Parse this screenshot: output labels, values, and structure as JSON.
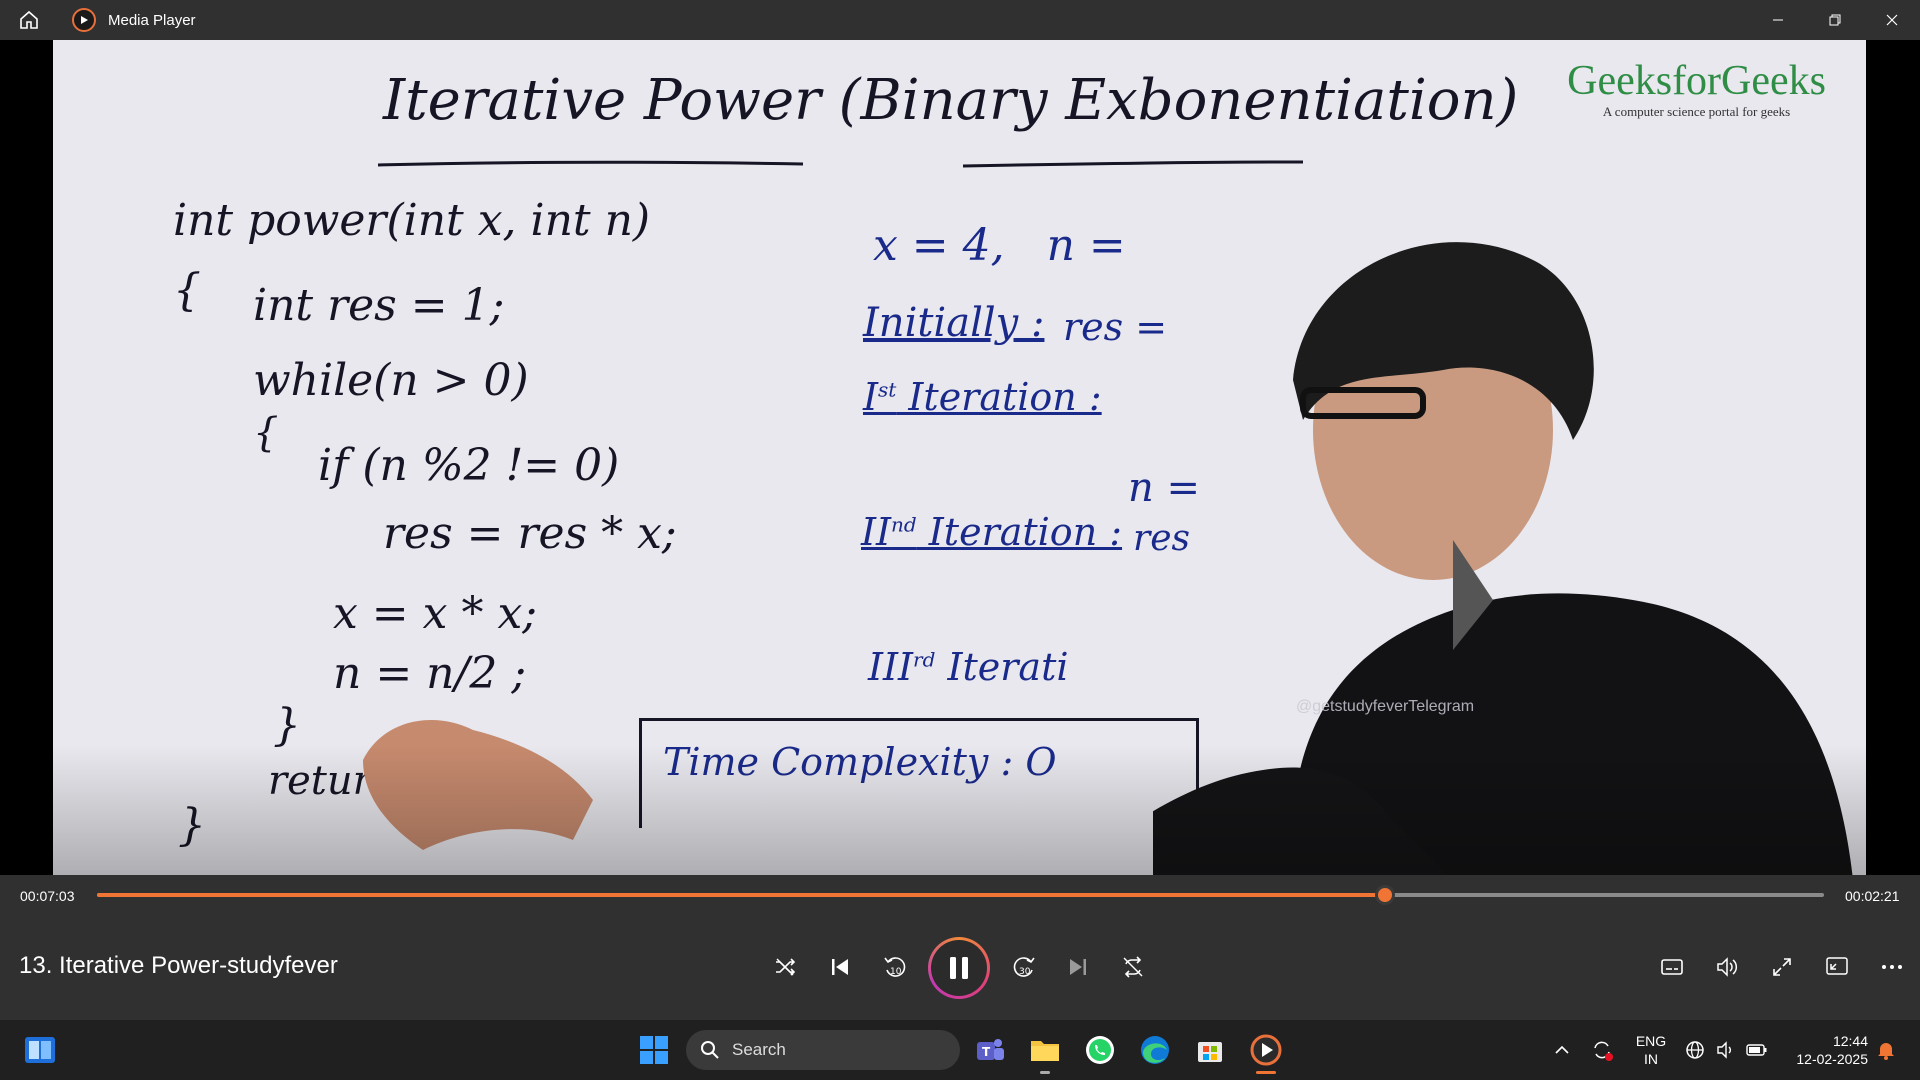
{
  "window": {
    "app_title": "Media Player",
    "controls": [
      "minimize",
      "restore",
      "close"
    ]
  },
  "video": {
    "board_title": "Iterative Power (Binary Exbonentiation)",
    "code_lines": [
      "int power(int x, int n)",
      "{",
      "int res = 1;",
      "while(n > 0)",
      "{",
      "if (n %2 != 0)",
      "res = res * x;",
      "x = x * x;",
      "n = n/2 ;",
      "}",
      "return",
      "}"
    ],
    "board_right": {
      "given": "x = 4,   n =",
      "initially": "Initially :",
      "initially_val": "res =",
      "iter1": "I",
      "iter1_sup": "st",
      "iter1_rest": " Iteration :",
      "n_eq": "n =",
      "iter2": "II",
      "iter2_sup": "nd",
      "iter2_rest": " Iteration :",
      "iter2_val": "res",
      "iter3": "III",
      "iter3_sup": "rd",
      "iter3_rest": " Iterati",
      "complexity": "Time Complexity : O"
    },
    "logo_title": "GeeksforGeeks",
    "logo_subtitle": "A computer science portal for geeks",
    "watermark": "@getstudyfeverTelegram"
  },
  "player": {
    "current_time": "00:07:03",
    "remaining_time": "00:02:21",
    "progress_fraction": 0.746,
    "title": "13. Iterative Power-studyfever",
    "accent_color": "#f07535"
  },
  "taskbar": {
    "search_label": "Search",
    "language_top": "ENG",
    "language_bottom": "IN",
    "time": "12:44",
    "date": "12-02-2025"
  }
}
